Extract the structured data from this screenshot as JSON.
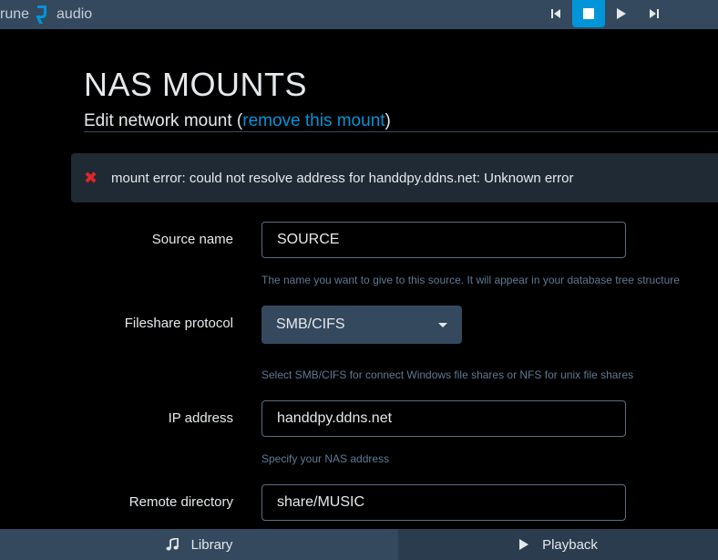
{
  "header": {
    "logo_word1": "rune",
    "logo_word2": "audio",
    "controls": [
      {
        "icon": "previous-icon",
        "active": false
      },
      {
        "icon": "stop-icon",
        "active": true
      },
      {
        "icon": "play-icon",
        "active": false
      },
      {
        "icon": "next-icon",
        "active": false
      }
    ],
    "accent_color": "#0095d8"
  },
  "page": {
    "title": "NAS MOUNTS",
    "subtitle_prefix": "Edit network mount (",
    "subtitle_link": "remove this mount",
    "subtitle_suffix": ")"
  },
  "alert": {
    "icon": "error-x-icon",
    "message": "mount error: could not resolve address for handdpy.ddns.net: Unknown error",
    "icon_color": "#e0262a"
  },
  "form": {
    "source_name": {
      "label": "Source name",
      "value": "SOURCE",
      "help": "The name you want to give to this source. It will appear in your database tree structure"
    },
    "protocol": {
      "label": "Fileshare protocol",
      "selected": "SMB/CIFS",
      "help": "Select SMB/CIFS for connect Windows file shares or NFS for unix file shares"
    },
    "ip_address": {
      "label": "IP address",
      "value": "handdpy.ddns.net",
      "help": "Specify your NAS address"
    },
    "remote_directory": {
      "label": "Remote directory",
      "value": "share/MUSIC"
    }
  },
  "footer": {
    "library_label": "Library",
    "playback_label": "Playback"
  }
}
